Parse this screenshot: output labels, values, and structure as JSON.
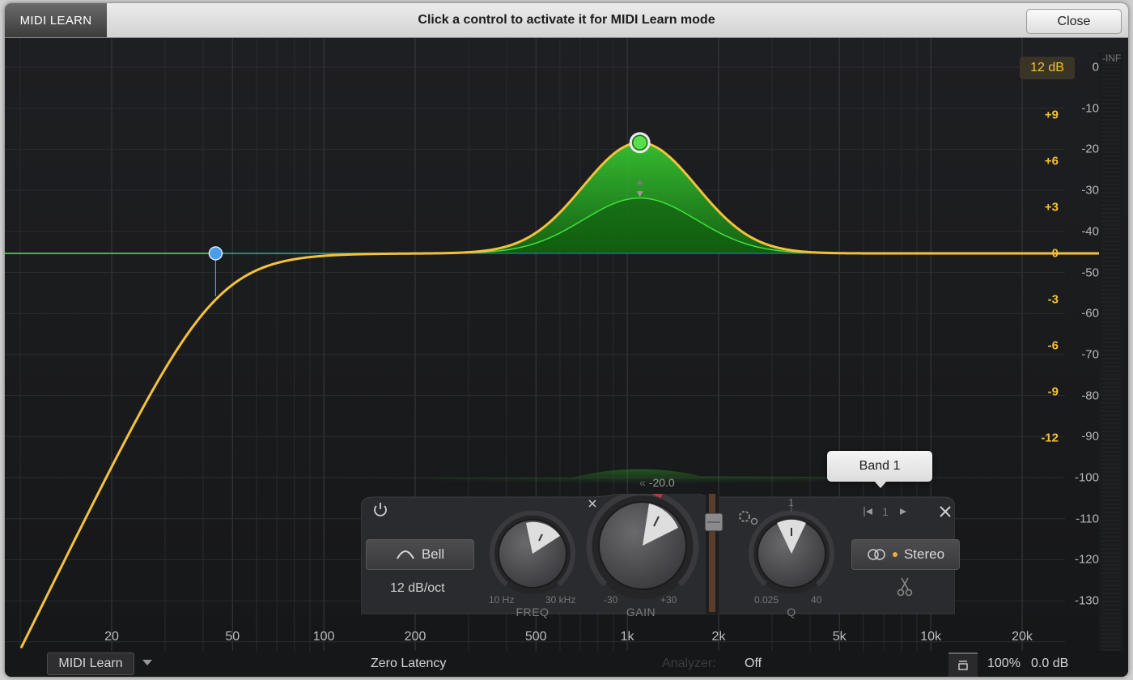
{
  "topbar": {
    "mode_badge": "MIDI LEARN",
    "message": "Click a control to activate it for MIDI Learn mode",
    "close_label": "Close"
  },
  "graph": {
    "frequency_labels": [
      "20",
      "50",
      "100",
      "200",
      "500",
      "1k",
      "2k",
      "5k",
      "10k",
      "20k"
    ],
    "gain_scale_labels": [
      "+9",
      "+6",
      "+3",
      "0",
      "-3",
      "-6",
      "-9",
      "-12"
    ],
    "spectrum_scale_labels": [
      "0",
      "-10",
      "-20",
      "-30",
      "-40",
      "-50",
      "-60",
      "-70",
      "-80",
      "-90",
      "-100",
      "-110",
      "-120",
      "-130"
    ],
    "display_range": "12 dB",
    "spectrum_top_label": "-INF",
    "colors": {
      "eq_curve": "#f4c23a",
      "band_fill": "#2fbf2a",
      "band_node": "#55e04a",
      "lowcut_node": "#4a9de8"
    }
  },
  "band_panel": {
    "shape_label": "Bell",
    "slope_label": "12 dB/oct",
    "freq": {
      "title": "FREQ",
      "min": "10 Hz",
      "max": "30 kHz"
    },
    "gain": {
      "title": "GAIN",
      "min": "-30",
      "max": "+30"
    },
    "q": {
      "title": "Q",
      "min": "0.025",
      "max": "40",
      "top": "1"
    },
    "output_level": "-20.0",
    "band_number": "1",
    "stereo_label": "Stereo",
    "tooltip": "Band 1"
  },
  "bottombar": {
    "midi_learn_label": "MIDI Learn",
    "latency_label": "Zero Latency",
    "analyzer_label": "Analyzer:",
    "analyzer_value": "Off",
    "zoom_label": "100%",
    "output_gain": "0.0 dB"
  }
}
